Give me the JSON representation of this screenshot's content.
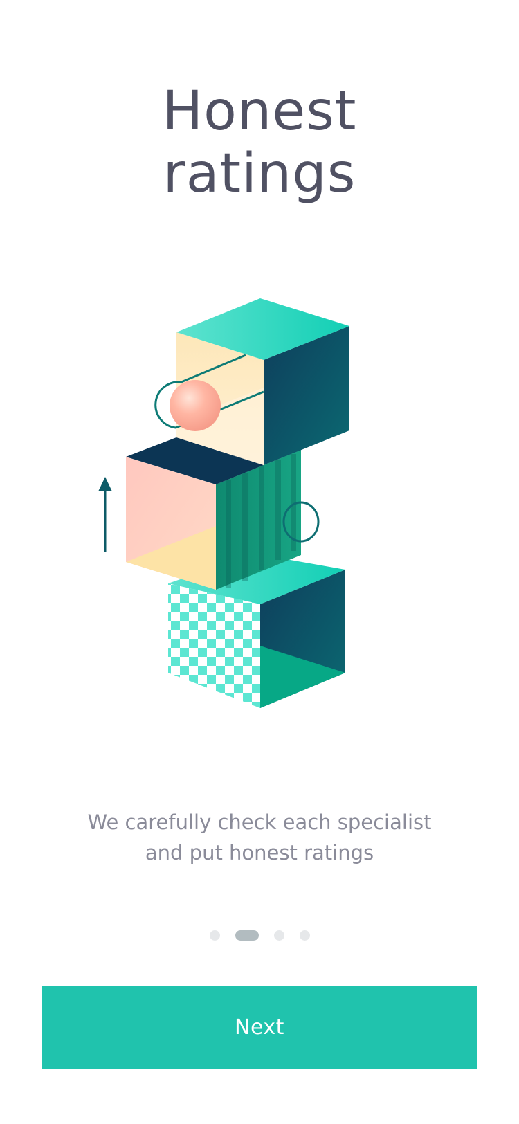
{
  "onboarding": {
    "title_line1": "Honest",
    "title_line2": "ratings",
    "description_line1": "We carefully check each specialist",
    "description_line2": "and put honest ratings",
    "illustration_icon": "stacked-cubes-illustration",
    "pager": {
      "total_pages": 4,
      "active_page": 2
    },
    "next_label": "Next"
  },
  "colors": {
    "title": "#505163",
    "description": "#8a8b99",
    "accent": "#20c3ad",
    "dot_inactive": "#e6e8ea",
    "dot_active": "#b2bcc0"
  }
}
